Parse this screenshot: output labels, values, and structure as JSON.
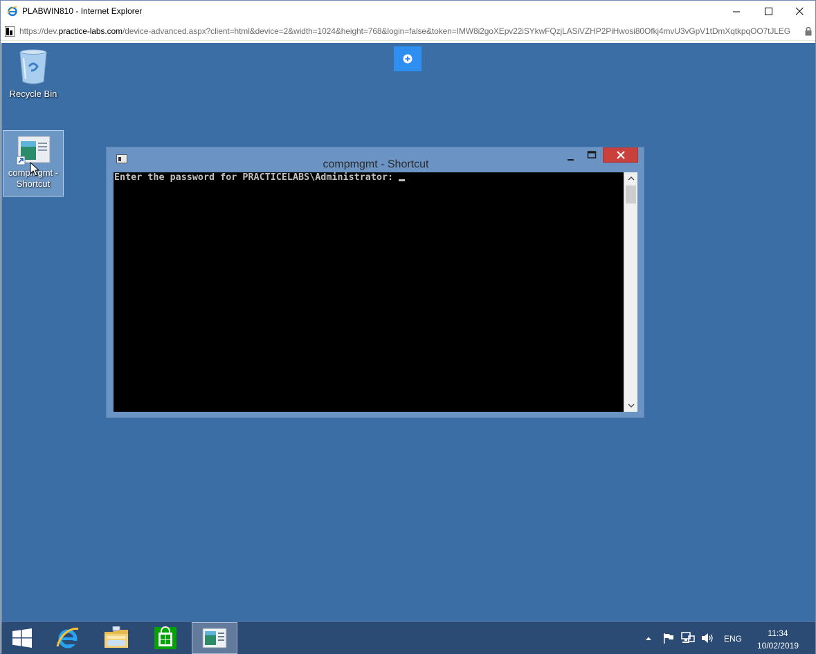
{
  "browser": {
    "window_title": "PLABWIN810 - Internet Explorer",
    "url_prefix": "https://dev.",
    "url_domain": "practice-labs.com",
    "url_rest": "/device-advanced.aspx?client=html&device=2&width=1024&height=768&login=false&token=IMW8i2goXEpv22iSYkwFQzjLASiVZHP2PiHwosi80Ofkj4mvU3vGpV1tDmXqtkpqOO7tJLEG"
  },
  "desktop": {
    "icons": [
      {
        "label": "Recycle Bin",
        "icon": "recycle-bin-icon"
      },
      {
        "label": "compmgmt - Shortcut",
        "icon": "compmgmt-shortcut-icon"
      }
    ]
  },
  "console": {
    "title": "compmgmt - Shortcut",
    "prompt": "Enter the password for PRACTICELABS\\Administrator: "
  },
  "taskbar": {
    "apps": [
      {
        "name": "Start",
        "icon": "windows-start-icon"
      },
      {
        "name": "Internet Explorer",
        "icon": "internet-explorer-icon"
      },
      {
        "name": "File Explorer",
        "icon": "file-explorer-icon"
      },
      {
        "name": "Store",
        "icon": "store-icon"
      },
      {
        "name": "compmgmt - Shortcut",
        "icon": "console-window-icon",
        "active": true
      }
    ],
    "tray": {
      "language": "ENG",
      "time": "11:34",
      "date": "10/02/2019"
    }
  },
  "colors": {
    "desktop_background": "#3a6ea5",
    "taskbar": "#2c4b74",
    "console_frame": "#6b93c4",
    "close_button": "#c9413c",
    "remote_toolbar_button": "#2f8ff0"
  }
}
